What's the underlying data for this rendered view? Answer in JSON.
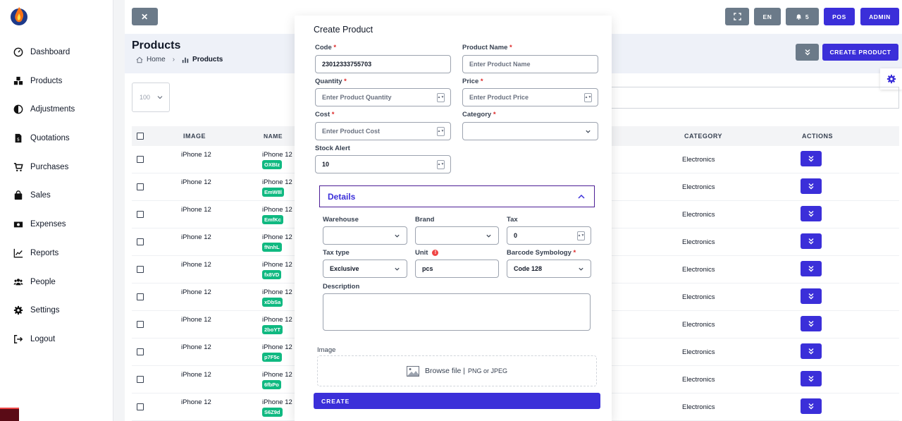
{
  "sidebar": {
    "items": [
      {
        "label": "Dashboard",
        "icon": "dashboard-icon"
      },
      {
        "label": "Products",
        "icon": "products-icon"
      },
      {
        "label": "Adjustments",
        "icon": "adjustments-icon"
      },
      {
        "label": "Quotations",
        "icon": "quotations-icon"
      },
      {
        "label": "Purchases",
        "icon": "cart-icon"
      },
      {
        "label": "Sales",
        "icon": "bag-icon"
      },
      {
        "label": "Expenses",
        "icon": "money-icon"
      },
      {
        "label": "Reports",
        "icon": "chart-line-icon"
      },
      {
        "label": "People",
        "icon": "people-icon"
      },
      {
        "label": "Settings",
        "icon": "gear-icon"
      },
      {
        "label": "Logout",
        "icon": "logout-icon"
      }
    ]
  },
  "topbar": {
    "close": "✕",
    "lang": "EN",
    "notifications": "5",
    "pos": "POS",
    "admin": "ADMIN"
  },
  "page": {
    "title": "Products",
    "breadcrumb_home": "Home",
    "breadcrumb_current": "Products",
    "create_product": "CREATE PRODUCT",
    "per_page": "100"
  },
  "table": {
    "headers": {
      "image": "IMAGE",
      "name": "NAME",
      "category": "CATEGORY",
      "actions": "ACTIONS"
    },
    "rows": [
      {
        "image": "iPhone 12",
        "name": "iPhone 12",
        "code": "OXBIz",
        "category": "Electronics"
      },
      {
        "image": "iPhone 12",
        "name": "iPhone 12",
        "code": "EmW8l",
        "category": "Electronics"
      },
      {
        "image": "iPhone 12",
        "name": "iPhone 12",
        "code": "EmfKc",
        "category": "Electronics"
      },
      {
        "image": "iPhone 12",
        "name": "iPhone 12",
        "code": "fNnhL",
        "category": "Electronics"
      },
      {
        "image": "iPhone 12",
        "name": "iPhone 12",
        "code": "fx8VD",
        "category": "Electronics"
      },
      {
        "image": "iPhone 12",
        "name": "iPhone 12",
        "code": "xDbSa",
        "category": "Electronics"
      },
      {
        "image": "iPhone 12",
        "name": "iPhone 12",
        "code": "2boYT",
        "category": "Electronics"
      },
      {
        "image": "iPhone 12",
        "name": "iPhone 12",
        "code": "p7F5c",
        "category": "Electronics"
      },
      {
        "image": "iPhone 12",
        "name": "iPhone 12",
        "code": "6fbPo",
        "category": "Electronics"
      },
      {
        "image": "iPhone 12",
        "name": "iPhone 12",
        "code": "S6Z9d",
        "category": "Electronics"
      }
    ]
  },
  "modal": {
    "title": "Create Product",
    "code_label": "Code",
    "code_value": "23012333755703",
    "name_label": "Product Name",
    "name_placeholder": "Enter Product Name",
    "quantity_label": "Quantity",
    "quantity_placeholder": "Enter Product Quantity",
    "price_label": "Price",
    "price_placeholder": "Enter Product Price",
    "cost_label": "Cost",
    "cost_placeholder": "Enter Product Cost",
    "category_label": "Category",
    "stock_alert_label": "Stock Alert",
    "stock_alert_value": "10",
    "details_title": "Details",
    "warehouse_label": "Warehouse",
    "brand_label": "Brand",
    "tax_label": "Tax",
    "tax_value": "0",
    "tax_type_label": "Tax type",
    "tax_type_value": "Exclusive",
    "unit_label": "Unit",
    "unit_value": "pcs",
    "barcode_label": "Barcode Symbology",
    "barcode_value": "Code 128",
    "description_label": "Description",
    "image_label": "Image",
    "browse_text": "Browse file |",
    "browse_hint": "PNG or JPEG",
    "create_button": "CREATE",
    "required_mark": "*",
    "warn_mark": "!"
  },
  "colors": {
    "accent": "#3b2fd9",
    "tag": "#10b981",
    "gray_button": "#6b7a89"
  }
}
